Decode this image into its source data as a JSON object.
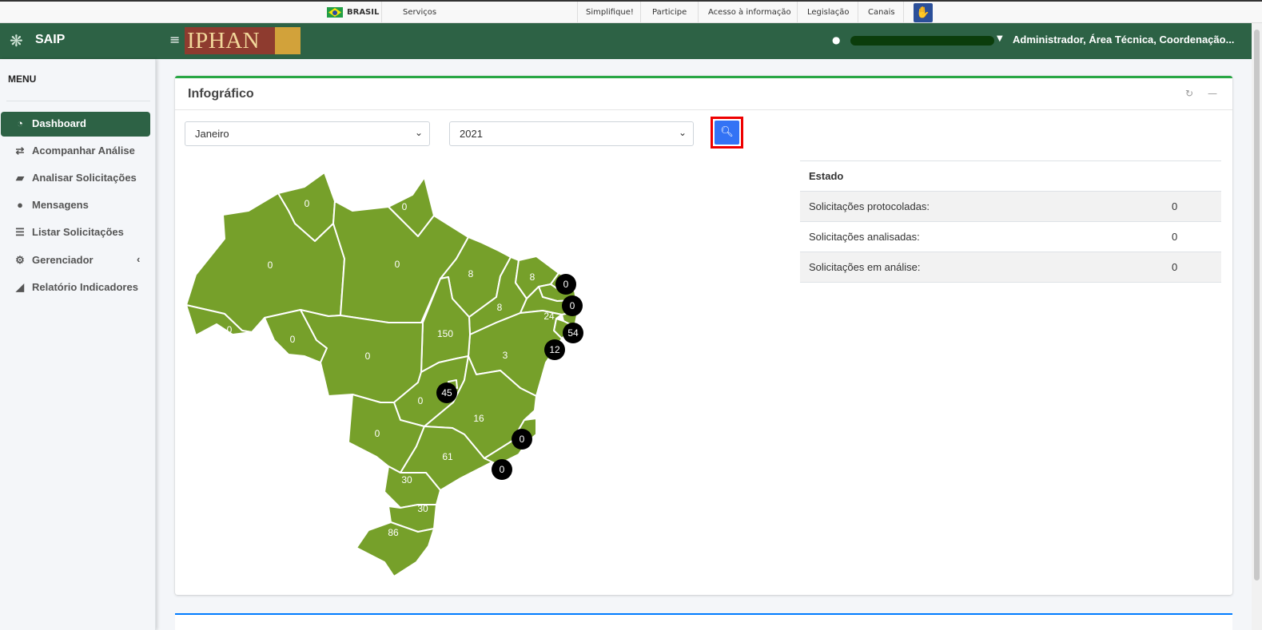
{
  "govbar": {
    "country": "BRASIL",
    "services": "Serviços",
    "links": [
      "Simplifique!",
      "Participe",
      "Acesso à informação",
      "Legislação",
      "Canais"
    ]
  },
  "brand": {
    "name": "SAIP",
    "logo_text": "IPHAN"
  },
  "header": {
    "user_label": "Administrador, Área Técnica, Coordenação..."
  },
  "sidebar": {
    "title": "MENU",
    "items": [
      {
        "label": "Dashboard",
        "icon": "dashboard-icon"
      },
      {
        "label": "Acompanhar Análise",
        "icon": "exchange-icon"
      },
      {
        "label": "Analisar Solicitações",
        "icon": "book-icon"
      },
      {
        "label": "Mensagens",
        "icon": "comments-icon"
      },
      {
        "label": "Listar Solicitações",
        "icon": "list-icon"
      },
      {
        "label": "Gerenciador",
        "icon": "cogs-icon"
      },
      {
        "label": "Relatório Indicadores",
        "icon": "area-chart-icon"
      }
    ]
  },
  "card": {
    "title": "Infográfico",
    "month_select": "Janeiro",
    "year_select": "2021"
  },
  "stats": {
    "header": "Estado",
    "rows": [
      {
        "label": "Solicitações protocoladas:",
        "value": "0"
      },
      {
        "label": "Solicitações analisadas:",
        "value": "0"
      },
      {
        "label": "Solicitações em análise:",
        "value": "0"
      }
    ]
  },
  "map": {
    "fill_color": "#76a02a",
    "states": {
      "RR": "0",
      "AP": "0",
      "AM": "0",
      "PA": "0",
      "MA": "8",
      "CE": "8",
      "RN": "0",
      "PB": "0",
      "PE": "24",
      "AL": "54",
      "SE": "12",
      "PI": "8",
      "AC": "0",
      "RO": "0",
      "MT": "0",
      "TO": "150",
      "BA": "3",
      "DF": "45",
      "GO": "0",
      "MG": "16",
      "ES": "0",
      "MS": "0",
      "SP": "61",
      "RJ": "0",
      "PR": "30",
      "SC": "30",
      "RS": "86"
    }
  }
}
